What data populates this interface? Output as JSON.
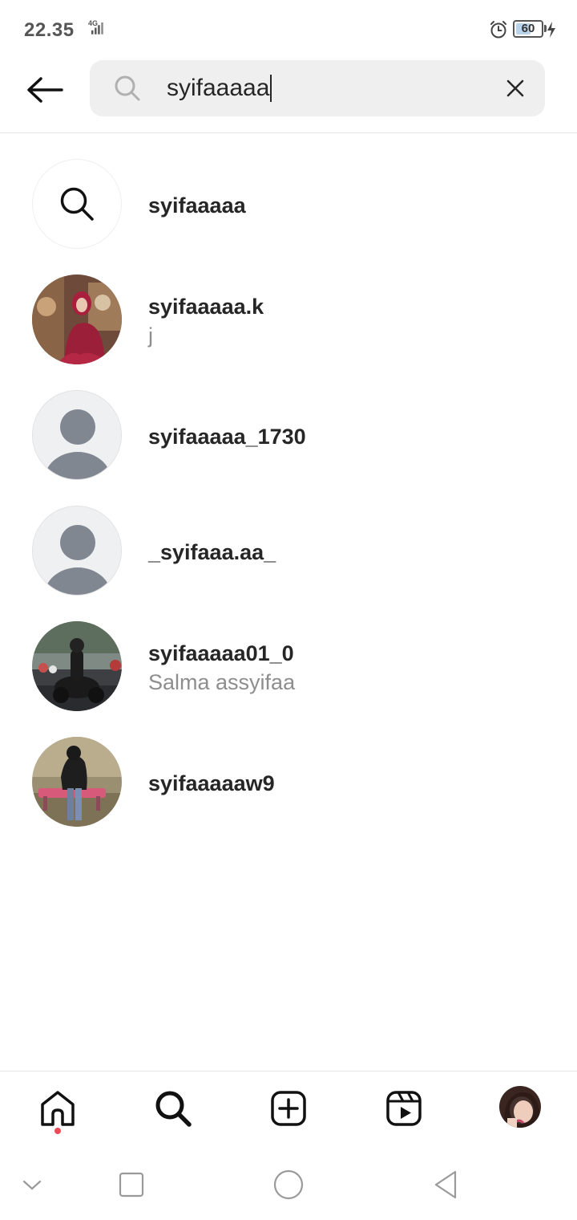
{
  "status_bar": {
    "time": "22.35",
    "network": "4G",
    "battery_level": "60",
    "battery_fraction": 0.6
  },
  "search": {
    "query": "syifaaaaa",
    "back_icon": "arrow-left-icon",
    "search_icon": "search-icon",
    "clear_icon": "close-icon"
  },
  "results": [
    {
      "type": "keyword",
      "username": "syifaaaaa",
      "subtitle": "",
      "avatar": "search-icon"
    },
    {
      "type": "account",
      "username": "syifaaaaa.k",
      "subtitle": "j",
      "avatar": "photo"
    },
    {
      "type": "account",
      "username": "syifaaaaa_1730",
      "subtitle": "",
      "avatar": "default-avatar"
    },
    {
      "type": "account",
      "username": "_syifaaa.aa_",
      "subtitle": "",
      "avatar": "default-avatar"
    },
    {
      "type": "account",
      "username": "syifaaaaa01_0",
      "subtitle": "Salma assyifaa",
      "avatar": "photo"
    },
    {
      "type": "account",
      "username": "syifaaaaaw9",
      "subtitle": "",
      "avatar": "photo"
    }
  ],
  "bottom_nav": {
    "items": [
      "home-icon",
      "search-icon",
      "create-post-icon",
      "reels-icon",
      "profile-avatar"
    ],
    "active": "search-icon",
    "notification_dot_color": "#ed4956"
  },
  "system_nav": {
    "items": [
      "chevron-down-icon",
      "recents-square-icon",
      "home-circle-icon",
      "back-triangle-icon"
    ]
  },
  "colors": {
    "text_primary": "#262626",
    "text_secondary": "#8e8e8e",
    "search_field_bg": "#efefef",
    "divider": "#e6e6e6"
  }
}
